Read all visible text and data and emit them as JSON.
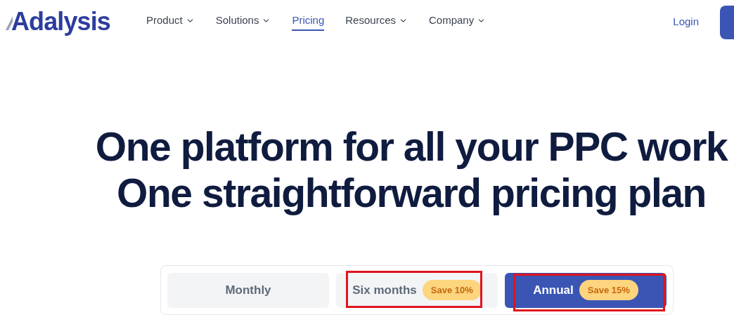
{
  "logo": {
    "text": "Adalysis"
  },
  "nav": [
    {
      "label": "Product",
      "dropdown": true,
      "selected": false
    },
    {
      "label": "Solutions",
      "dropdown": true,
      "selected": false
    },
    {
      "label": "Pricing",
      "dropdown": false,
      "selected": true
    },
    {
      "label": "Resources",
      "dropdown": true,
      "selected": false
    },
    {
      "label": "Company",
      "dropdown": true,
      "selected": false
    }
  ],
  "login": "Login",
  "headline": [
    "One platform for all your PPC work",
    "One straightforward pricing plan"
  ],
  "billing_tabs": [
    {
      "label": "Monthly",
      "selected": false,
      "highlighted": false
    },
    {
      "label": "Six months",
      "badge": "Save 10%",
      "selected": false,
      "highlighted": true
    },
    {
      "label": "Annual",
      "badge": "Save 15%",
      "selected": true,
      "highlighted": true
    }
  ]
}
